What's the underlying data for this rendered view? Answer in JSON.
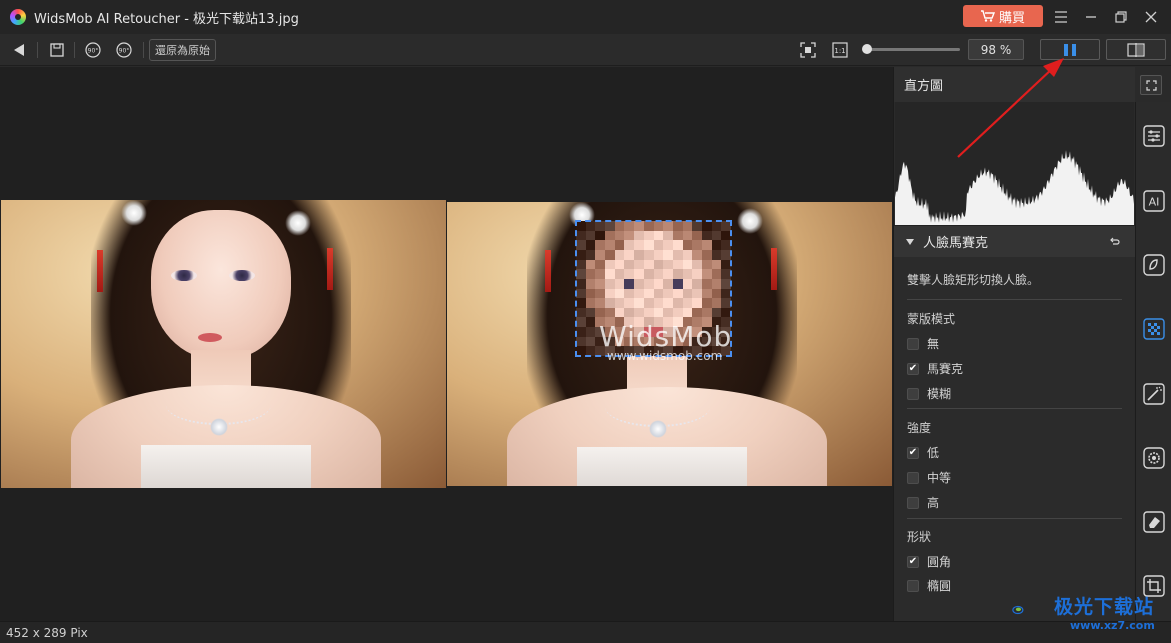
{
  "window": {
    "title": "WidsMob AI Retoucher - 极光下载站13.jpg",
    "buy_label": "購買"
  },
  "toolbar": {
    "revert_label": "還原為原始",
    "zoom_level": "98 %",
    "zoom_fraction": 0.02
  },
  "panel": {
    "histogram_title": "直方圖",
    "section_title": "人臉馬賽克",
    "hint": "雙擊人臉矩形切換人臉。",
    "mask_mode": {
      "title": "蒙版模式",
      "options": [
        {
          "label": "無",
          "checked": false
        },
        {
          "label": "馬賽克",
          "checked": true
        },
        {
          "label": "模糊",
          "checked": false
        }
      ]
    },
    "strength": {
      "title": "強度",
      "options": [
        {
          "label": "低",
          "checked": true
        },
        {
          "label": "中等",
          "checked": false
        },
        {
          "label": "高",
          "checked": false
        }
      ]
    },
    "shape": {
      "title": "形狀",
      "options": [
        {
          "label": "圓角",
          "checked": true
        },
        {
          "label": "橢圓",
          "checked": false
        }
      ]
    }
  },
  "preview": {
    "watermark": "WidsMob",
    "watermark_url": "www.widsmob.com"
  },
  "status": {
    "dimensions": "452 x 289 Pix"
  },
  "brand": {
    "name": "极光下载站",
    "url": "www.xz7.com"
  },
  "colors": {
    "accent": "#4b8ff0",
    "buy": "#e8664f",
    "arrow": "#e01e1e"
  }
}
